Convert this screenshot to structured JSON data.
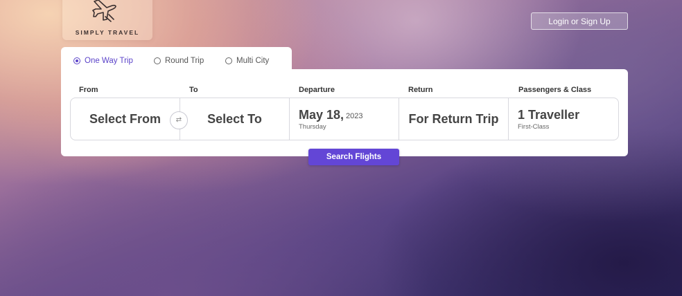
{
  "brand": {
    "name": "SIMPLY TRAVEL",
    "logo_icon": "airplane-icon"
  },
  "header": {
    "login_label": "Login or Sign Up"
  },
  "trip_types": {
    "selected": "one_way",
    "options": [
      {
        "id": "one_way",
        "label": "One Way Trip"
      },
      {
        "id": "round",
        "label": "Round Trip"
      },
      {
        "id": "multi",
        "label": "Multi City"
      }
    ]
  },
  "search": {
    "labels": {
      "from": "From",
      "to": "To",
      "departure": "Departure",
      "return": "Return",
      "passengers": "Passengers & Class"
    },
    "from_value": "Select From",
    "to_value": "Select To",
    "swap_icon": "swap-arrows-icon",
    "departure": {
      "date": "May 18,",
      "year": "2023",
      "weekday": "Thursday"
    },
    "return_value": "For Return Trip",
    "passengers": {
      "count": "1 Traveller",
      "class": "First-Class"
    },
    "button_label": "Search Flights"
  },
  "colors": {
    "accent": "#6346d6",
    "selected_option": "#5b43c9"
  }
}
